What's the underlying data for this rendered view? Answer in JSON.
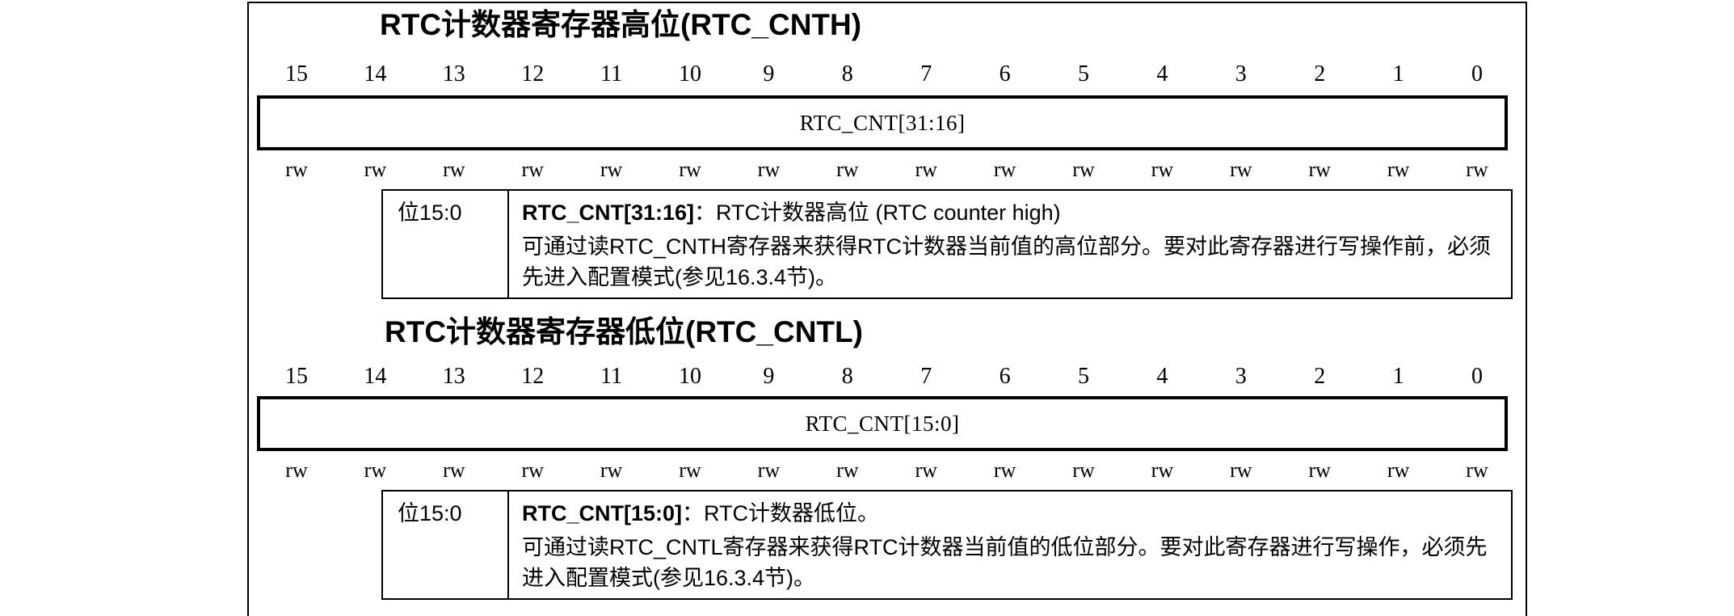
{
  "bit_numbers": [
    "15",
    "14",
    "13",
    "12",
    "11",
    "10",
    "9",
    "8",
    "7",
    "6",
    "5",
    "4",
    "3",
    "2",
    "1",
    "0"
  ],
  "access": [
    "rw",
    "rw",
    "rw",
    "rw",
    "rw",
    "rw",
    "rw",
    "rw",
    "rw",
    "rw",
    "rw",
    "rw",
    "rw",
    "rw",
    "rw",
    "rw"
  ],
  "cnth": {
    "title": "RTC计数器寄存器高位(RTC_CNTH)",
    "field": "RTC_CNT[31:16]",
    "bits_label": "位15:0",
    "field_name": "RTC_CNT[31:16]",
    "field_sep": "：",
    "field_summary": "RTC计数器高位 (RTC counter high)",
    "description": "可通过读RTC_CNTH寄存器来获得RTC计数器当前值的高位部分。要对此寄存器进行写操作前，必须先进入配置模式(参见16.3.4节)。"
  },
  "cntl": {
    "title": "RTC计数器寄存器低位(RTC_CNTL)",
    "field": "RTC_CNT[15:0]",
    "bits_label": "位15:0",
    "field_name": "RTC_CNT[15:0]",
    "field_sep": "：",
    "field_summary": "RTC计数器低位。",
    "description": "可通过读RTC_CNTL寄存器来获得RTC计数器当前值的低位部分。要对此寄存器进行写操作，必须先进入配置模式(参见16.3.4节)。"
  }
}
